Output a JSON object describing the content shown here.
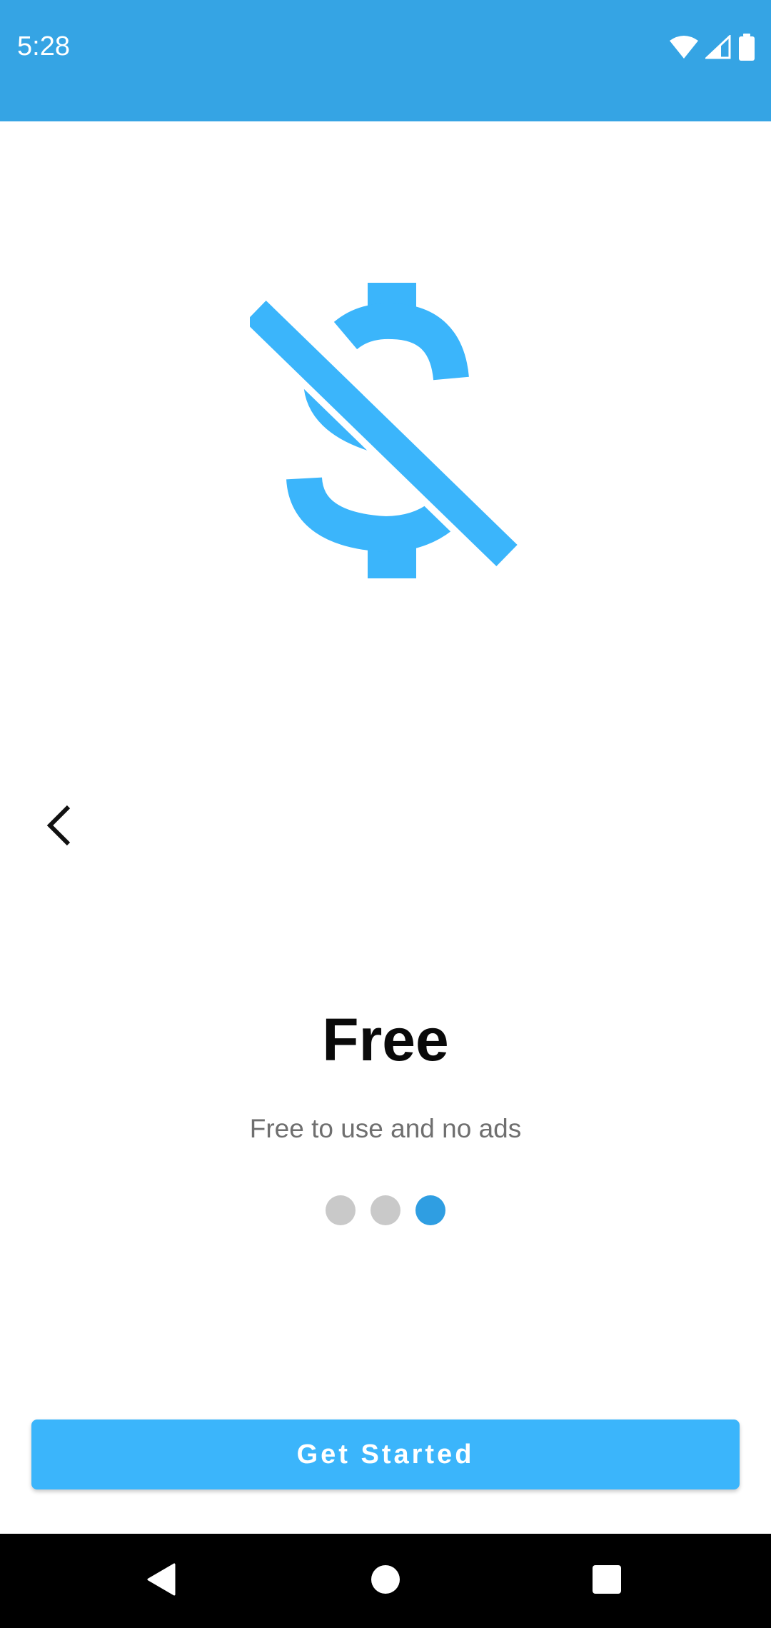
{
  "status_bar": {
    "time": "5:28",
    "icons": [
      "wifi-icon",
      "signal-icon",
      "battery-icon"
    ]
  },
  "hero": {
    "icon": "money-off-icon",
    "color": "#3bb5fb"
  },
  "navigation": {
    "back_icon": "chevron-left-icon"
  },
  "content": {
    "title": "Free",
    "subtitle": "Free to use and no ads"
  },
  "pager": {
    "total_pages": 3,
    "active_page": 3,
    "active_color": "#2f9ee2",
    "inactive_color": "#c9c9c9"
  },
  "cta": {
    "label": "Get Started",
    "color": "#3bb5fb"
  },
  "system_nav": {
    "buttons": [
      "back-triangle-icon",
      "home-circle-icon",
      "recents-square-icon"
    ]
  },
  "colors": {
    "status_bar": "#35a4e4",
    "title": "#0a0a0a",
    "subtitle": "#6f6f6f"
  }
}
